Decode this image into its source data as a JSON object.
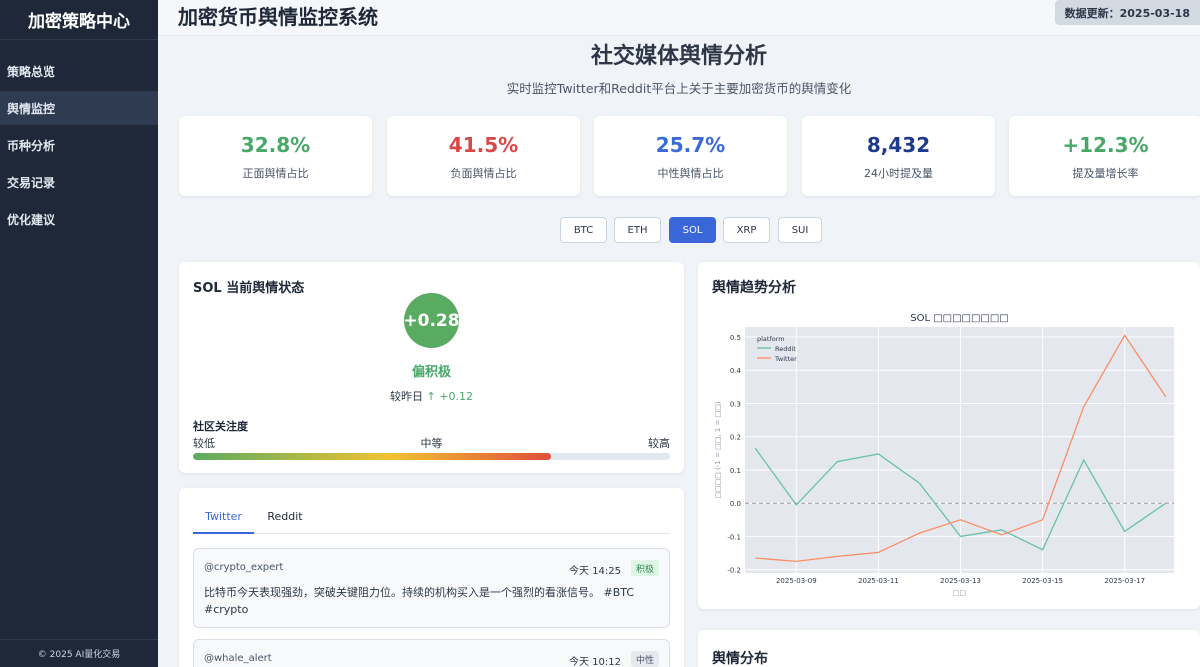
{
  "sidebar": {
    "brand": "加密策略中心",
    "items": [
      {
        "label": "策略总览"
      },
      {
        "label": "舆情监控"
      },
      {
        "label": "币种分析"
      },
      {
        "label": "交易记录"
      },
      {
        "label": "优化建议"
      }
    ],
    "footer": "© 2025 AI量化交易"
  },
  "topbar": {
    "title": "加密货币舆情监控系统",
    "update": "数据更新：2025-03-18"
  },
  "header": {
    "title": "社交媒体舆情分析",
    "subtitle": "实时监控Twitter和Reddit平台上关于主要加密货币的舆情变化"
  },
  "stats": [
    {
      "value": "32.8%",
      "label": "正面舆情占比"
    },
    {
      "value": "41.5%",
      "label": "负面舆情占比"
    },
    {
      "value": "25.7%",
      "label": "中性舆情占比"
    },
    {
      "value": "8,432",
      "label": "24小时提及量"
    },
    {
      "value": "+12.3%",
      "label": "提及量增长率"
    }
  ],
  "coins": [
    "BTC",
    "ETH",
    "SOL",
    "XRP",
    "SUI"
  ],
  "status": {
    "title": "SOL 当前舆情状态",
    "score": "+0.28",
    "label": "偏积极",
    "change_prefix": "较昨日",
    "change_arrow": "↑",
    "change_value": "+0.12",
    "attention_title": "社区关注度",
    "attention_low": "较低",
    "attention_mid": "中等",
    "attention_high": "较高",
    "attention_level": 0.75
  },
  "feed": {
    "tabs": [
      "Twitter",
      "Reddit"
    ],
    "posts": [
      {
        "user": "@crypto_expert",
        "time": "今天 14:25",
        "tag": "积极",
        "text": "比特币今天表现强劲，突破关键阻力位。持续的机构买入是一个强烈的看涨信号。 #BTC #crypto"
      },
      {
        "user": "@whale_alert",
        "time": "今天 10:12",
        "tag": "中性",
        "text": ""
      }
    ]
  },
  "trend": {
    "title": "舆情趋势分析"
  },
  "distribution": {
    "title": "舆情分布"
  },
  "colors": {
    "accent": "#3a66d8",
    "positive": "#48a868",
    "negative": "#d94848",
    "neutral": "#3a6ad6",
    "reddit_line": "#66c2a5",
    "twitter_line": "#fc8d62"
  },
  "chart_data": {
    "type": "line",
    "title": "SOL □□□□□□□□",
    "xlabel": "□□",
    "ylabel": "□□□□ (-1 = □□, 1 = □□)",
    "x": [
      "2025-03-08",
      "2025-03-09",
      "2025-03-10",
      "2025-03-11",
      "2025-03-12",
      "2025-03-13",
      "2025-03-14",
      "2025-03-15",
      "2025-03-16",
      "2025-03-17",
      "2025-03-18"
    ],
    "xticks": [
      "2025-03-09",
      "2025-03-11",
      "2025-03-13",
      "2025-03-15",
      "2025-03-17"
    ],
    "yticks": [
      -0.2,
      -0.1,
      0.0,
      0.1,
      0.2,
      0.3,
      0.4,
      0.5
    ],
    "ylim": [
      -0.21,
      0.53
    ],
    "legend_title": "platform",
    "legend_position": "top-left",
    "grid": true,
    "series": [
      {
        "name": "Reddit",
        "values": [
          0.165,
          -0.005,
          0.125,
          0.148,
          0.06,
          -0.1,
          -0.08,
          -0.14,
          0.13,
          -0.085,
          0.0
        ]
      },
      {
        "name": "Twitter",
        "values": [
          -0.165,
          -0.175,
          -0.16,
          -0.148,
          -0.09,
          -0.05,
          -0.095,
          -0.05,
          0.29,
          0.505,
          0.32
        ]
      }
    ]
  }
}
